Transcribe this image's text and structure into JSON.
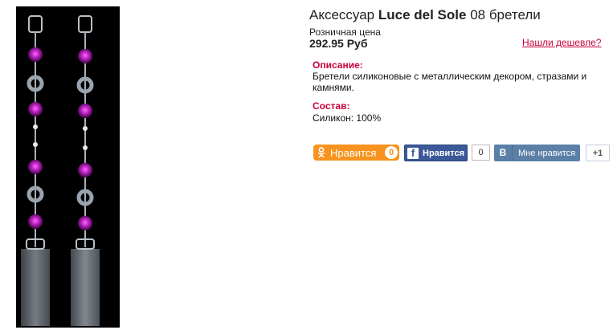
{
  "product": {
    "title_prefix": "Аксессуар ",
    "brand": "Luce del Sole",
    "title_suffix": " 08 бретели",
    "price_label": "Розничная цена",
    "price": "292.95 Руб",
    "cheaper_link": "Нашли дешевле?"
  },
  "description": {
    "heading": "Описание:",
    "text": "Бретели силиконовые с металлическим декором, стразами и камнями."
  },
  "composition": {
    "heading": "Состав:",
    "text": "Силикон: 100%"
  },
  "social": {
    "ok_label": "Нравится",
    "ok_count": "0",
    "fb_icon": "f",
    "fb_label": "Нравится",
    "fb_count": "0",
    "vk_icon": "B",
    "vk_label": "Мне нравится",
    "vk_count": "+1"
  }
}
